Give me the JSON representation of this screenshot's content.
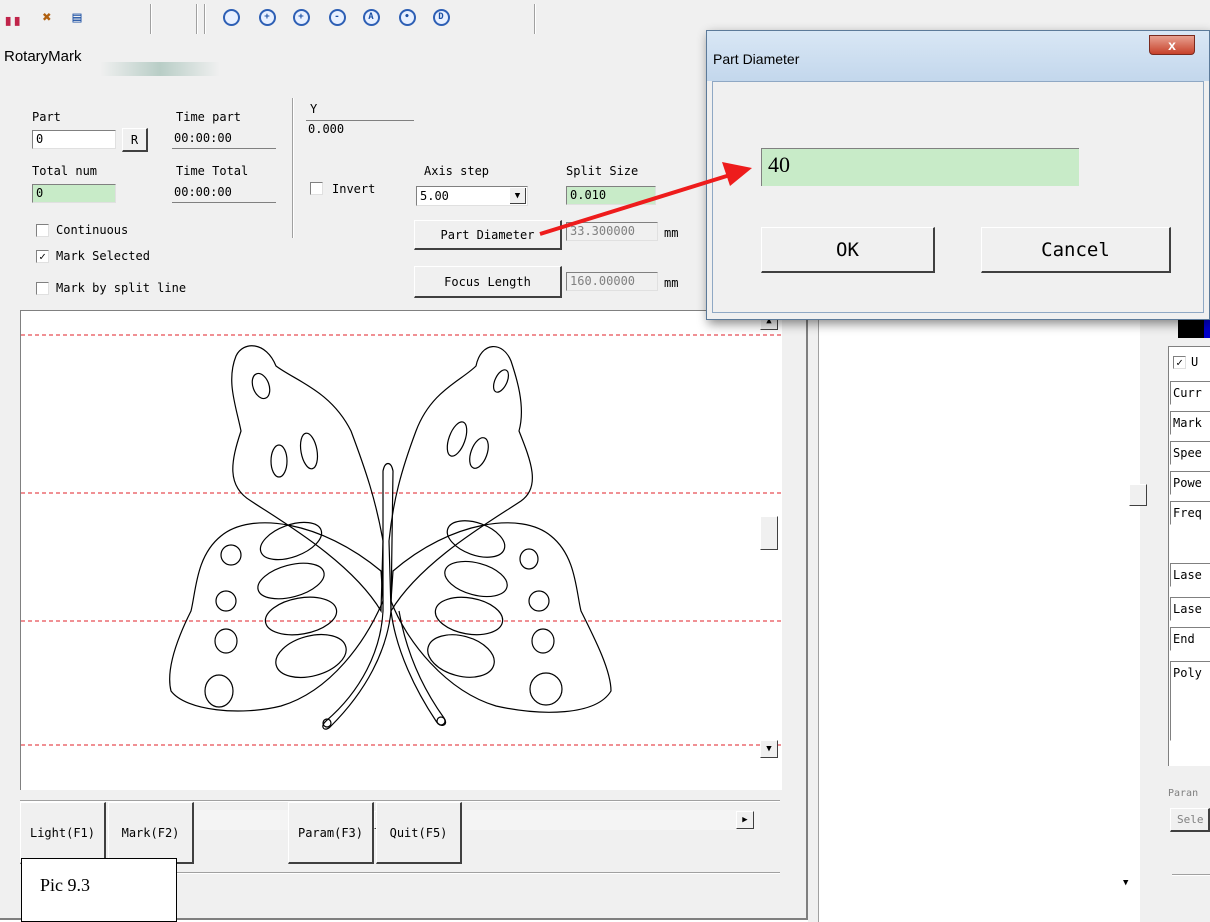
{
  "toolbar": {
    "icons": [
      "save-icon",
      "tools-icon",
      "list-icon",
      "zoom-icon",
      "zoom-all-icon",
      "zoom-in-icon",
      "zoom-out-icon",
      "zoom-fit-icon",
      "zoom-select-icon",
      "page-icon"
    ]
  },
  "rotary": {
    "title": "RotaryMark",
    "part_label": "Part",
    "part_value": "0",
    "reset_button": "R",
    "time_part_label": "Time part",
    "time_part_value": "00:00:00",
    "total_num_label": "Total num",
    "total_num_value": "0",
    "time_total_label": "Time Total",
    "time_total_value": "00:00:00",
    "y_label": "Y",
    "y_value": "0.000",
    "invert_label": "Invert",
    "axis_step_label": "Axis step",
    "axis_step_value": "5.00",
    "split_size_label": "Split Size",
    "split_size_value": "0.010",
    "continuous_label": "Continuous",
    "mark_selected_label": "Mark Selected",
    "mark_selected_checked": true,
    "mark_split_label": "Mark by split line",
    "part_diameter_button": "Part Diameter",
    "part_diameter_value": "33.300000",
    "focus_length_button": "Focus Length",
    "focus_length_value": "160.00000",
    "unit_mm": "mm",
    "light_button": "Light(F1)",
    "mark_button": "Mark(F2)",
    "param_button": "Param(F3)",
    "quit_button": "Quit(F5)"
  },
  "dialog": {
    "title": "Part Diameter",
    "close_label": "x",
    "input_value": "40",
    "ok_label": "OK",
    "cancel_label": "Cancel"
  },
  "right_panel": {
    "items": [
      "U",
      "Curr",
      "Mark",
      "Spee",
      "Powe",
      "Freq",
      "Lase",
      "Lase",
      "End",
      "Poly"
    ],
    "param_label": "Paran",
    "select_label": "Sele"
  },
  "caption": "Pic 9.3",
  "colors": {
    "accent_arrow": "#ee1c1c",
    "split_line": "#e0202a",
    "field_green": "#c8ebc8"
  }
}
